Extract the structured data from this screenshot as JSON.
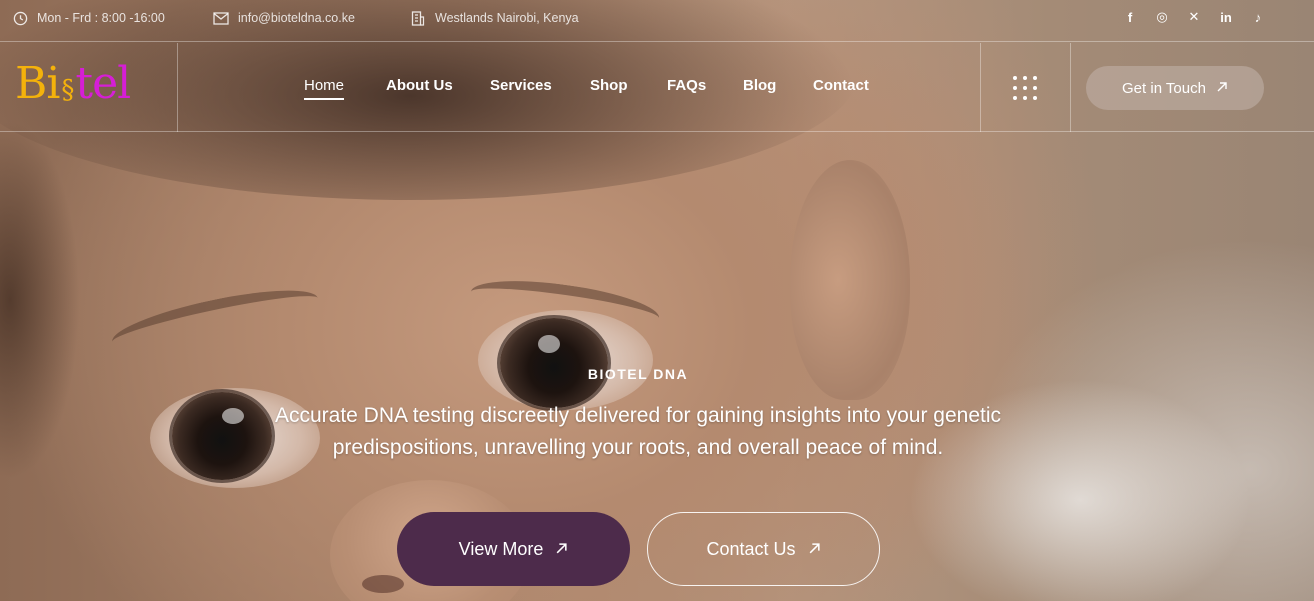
{
  "topbar": {
    "hours": "Mon - Frd : 8:00 -16:00",
    "email": "info@bioteldna.co.ke",
    "address": "Westlands Nairobi, Kenya",
    "icons": {
      "hours": "clock-icon",
      "email": "mail-icon",
      "address": "building-icon"
    },
    "social": [
      {
        "name": "facebook-icon",
        "glyph": "f"
      },
      {
        "name": "instagram-icon",
        "glyph": "◎"
      },
      {
        "name": "x-icon",
        "glyph": "✕"
      },
      {
        "name": "linkedin-icon",
        "glyph": "in"
      },
      {
        "name": "tiktok-icon",
        "glyph": "♪"
      }
    ]
  },
  "logo": {
    "part1": "Bi",
    "part2": "tel"
  },
  "nav": {
    "items": [
      "Home",
      "About Us",
      "Services",
      "Shop",
      "FAQs",
      "Blog",
      "Contact"
    ],
    "active": "Home",
    "cta": "Get in Touch"
  },
  "hero": {
    "eyebrow": "BIOTEL DNA",
    "lead": "Accurate DNA testing discreetly delivered for gaining insights into your genetic predispositions, unravelling your roots, and overall peace of mind.",
    "primary_button": "View More",
    "secondary_button": "Contact Us"
  },
  "colors": {
    "logo_gold": "#f4b20b",
    "logo_magenta": "#d61ed6",
    "primary_button": "#4d2b4b"
  }
}
